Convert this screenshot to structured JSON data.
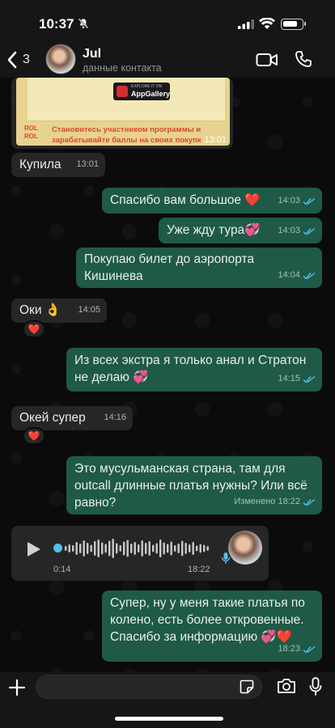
{
  "status_bar": {
    "time": "10:37",
    "battery_level": 0.82
  },
  "header": {
    "back_count": "3",
    "contact_name": "Jul",
    "contact_subtitle": "данные контакта"
  },
  "image_message": {
    "badge_small": "EXPLORE IT ON",
    "badge_big": "AppGallery",
    "brand": "ROL ROL",
    "promo_text": "Становитесь участником программы и зарабатывайте баллы на своих покупк",
    "time": "13:01"
  },
  "messages": [
    {
      "dir": "in",
      "text": "Купила",
      "time": "13:01"
    },
    {
      "dir": "out",
      "text": "Спасибо вам большое ❤️",
      "time": "14:03"
    },
    {
      "dir": "out",
      "text": "Уже жду тура💞",
      "time": "14:03"
    },
    {
      "dir": "out",
      "text": "Покупаю билет до аэропорта Кишинева",
      "time": "14:04"
    },
    {
      "dir": "in",
      "text": "Оки 👌",
      "time": "14:05",
      "reaction": "❤️"
    },
    {
      "dir": "out",
      "text": "Из всех экстра я только анал и Стратон не делаю 💞",
      "time": "14:15"
    },
    {
      "dir": "in",
      "text": "Окей супер",
      "time": "14:16",
      "reaction": "❤️"
    },
    {
      "dir": "out",
      "text": "Это мусульманская страна, там для outcall длинные платья нужны? Или всё равно?",
      "time": "Изменено 18:22"
    },
    {
      "dir": "out",
      "text": "Супер, ну у меня такие платья по колено, есть более откровенные. Спасибо за информацию 💞❤️",
      "time": "18:23"
    }
  ],
  "voice_message": {
    "duration": "0:14",
    "time": "18:22",
    "progress": 0.0
  },
  "input": {
    "placeholder": ""
  },
  "colors": {
    "outgoing": "#1f5a46",
    "incoming": "#262626",
    "read_ticks": "#53bdeb"
  }
}
